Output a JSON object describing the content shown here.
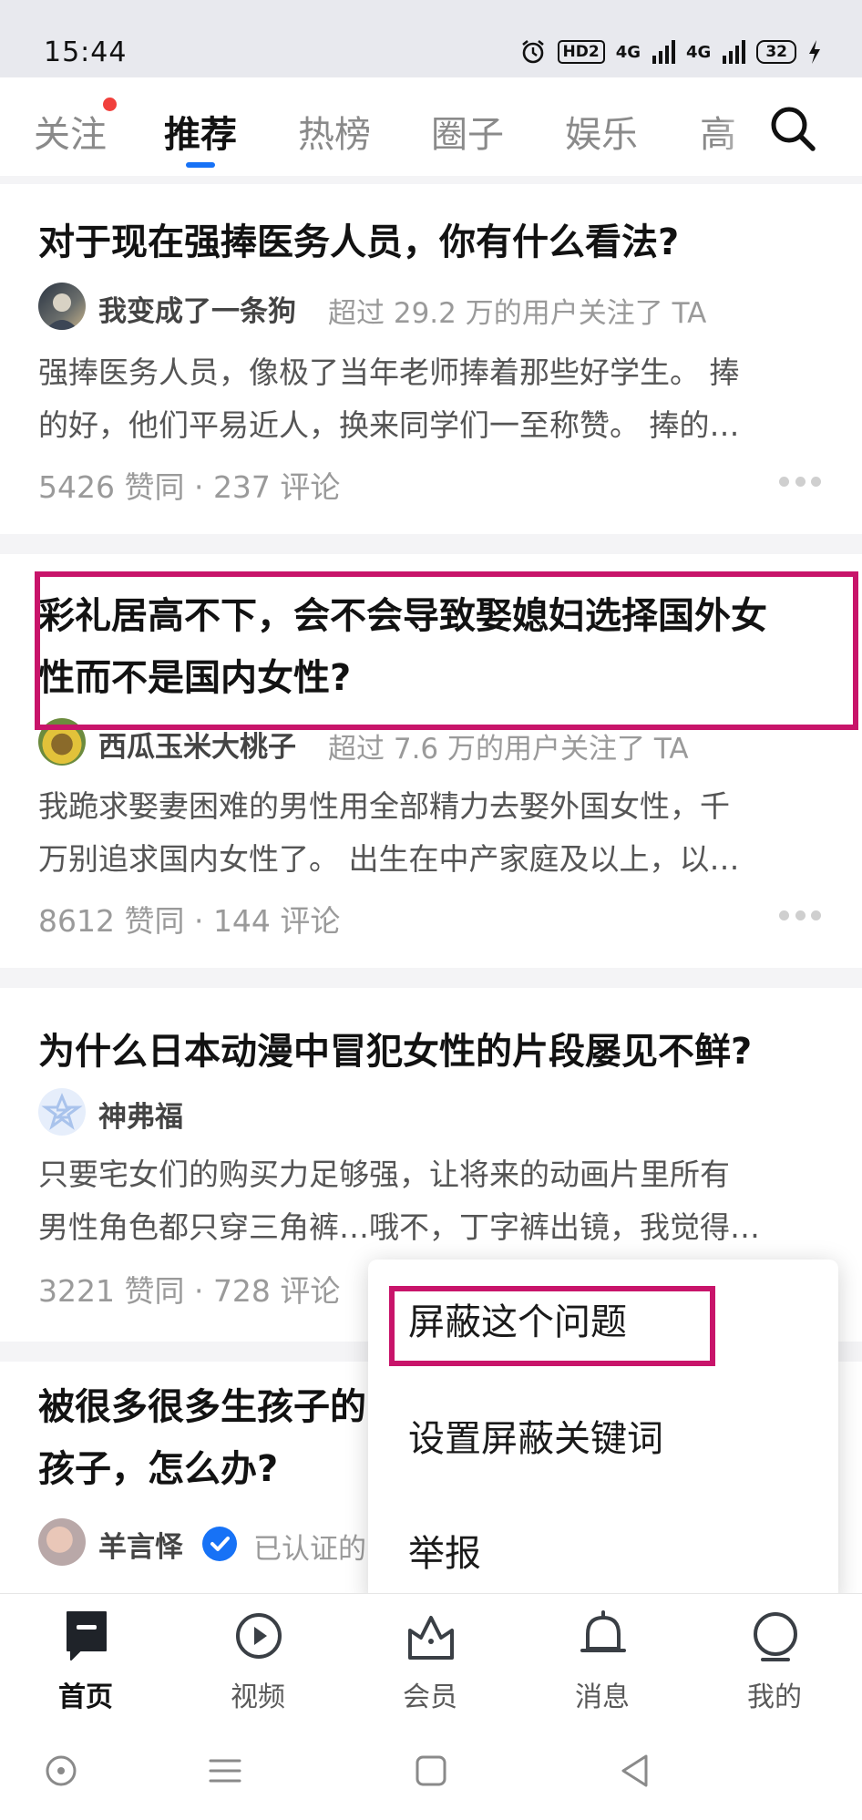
{
  "status_bar": {
    "time": "15:44",
    "hd_label": "HD2",
    "signal_1": "4G",
    "signal_2": "4G",
    "battery": "32"
  },
  "top_tabs": [
    {
      "label": "关注",
      "active": false,
      "has_dot": true
    },
    {
      "label": "推荐",
      "active": true
    },
    {
      "label": "热榜",
      "active": false
    },
    {
      "label": "圈子",
      "active": false
    },
    {
      "label": "娱乐",
      "active": false
    },
    {
      "label": "高",
      "active": false
    }
  ],
  "search_icon": "search-icon",
  "feed": [
    {
      "title_lines": [
        "对于现在强捧医务人员，你有什么看法?"
      ],
      "author": "我变成了一条狗",
      "author_meta": "超过 29.2 万的用户关注了 TA",
      "excerpt_lines": [
        "强捧医务人员，像极了当年老师捧着那些好学生。 捧",
        "的好，他们平易近人，换来同学们一至称赞。 捧的…"
      ],
      "stats": "5426 赞同 · 237 评论"
    },
    {
      "title_lines": [
        "彩礼居高不下，会不会导致娶媳妇选择国外女",
        "性而不是国内女性?"
      ],
      "author": "西瓜玉米大桃子",
      "author_meta": "超过 7.6 万的用户关注了 TA",
      "excerpt_lines": [
        "我跪求娶妻困难的男性用全部精力去娶外国女性，千",
        "万别追求国内女性了。 出生在中产家庭及以上，以…"
      ],
      "stats": "8612 赞同 · 144 评论"
    },
    {
      "title_lines": [
        "为什么日本动漫中冒犯女性的片段屡见不鲜?"
      ],
      "author": "神弗福",
      "author_meta": "",
      "excerpt_lines": [
        "只要宅女们的购买力足够强，让将来的动画片里所有",
        "男性角色都只穿三角裤…哦不，丁字裤出镜，我觉得…"
      ],
      "stats": "3221 赞同 · 728 评论"
    },
    {
      "title_lines": [
        "被很多很多生孩子的",
        "孩子，怎么办?"
      ],
      "author": "羊言怿",
      "author_meta": "已认证的"
    }
  ],
  "popup_menu": {
    "items": [
      "屏蔽这个问题",
      "设置屏蔽关键词",
      "举报"
    ]
  },
  "bottom_nav": [
    {
      "label": "首页",
      "icon": "home-icon",
      "active": true
    },
    {
      "label": "视频",
      "icon": "video-icon",
      "active": false
    },
    {
      "label": "会员",
      "icon": "vip-crown-icon",
      "active": false
    },
    {
      "label": "消息",
      "icon": "bell-icon",
      "active": false
    },
    {
      "label": "我的",
      "icon": "profile-icon",
      "active": false
    }
  ],
  "system_nav": [
    "assistant-icon",
    "menu-icon",
    "home-square-icon",
    "back-icon"
  ],
  "colors": {
    "accent": "#1772f6",
    "highlight": "#c8146a",
    "notification_dot": "#f1403c"
  }
}
